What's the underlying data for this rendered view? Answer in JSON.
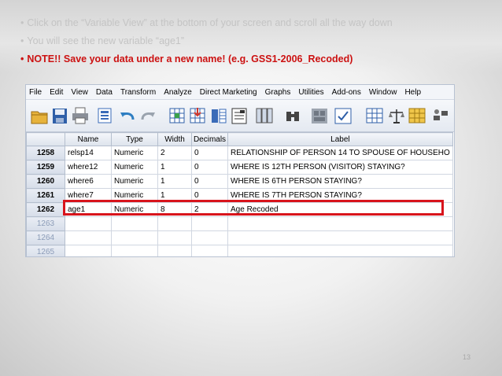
{
  "bullets": [
    {
      "text": "Click on the “Variable View” at the bottom of your screen and scroll all the way down",
      "style": "normal"
    },
    {
      "text": "You will see the new variable “age1”",
      "style": "normal"
    },
    {
      "text": "NOTE!! Save your data under a new name! (e.g. GSS1-2006_Recoded)",
      "style": "note"
    }
  ],
  "menu": [
    "File",
    "Edit",
    "View",
    "Data",
    "Transform",
    "Analyze",
    "Direct Marketing",
    "Graphs",
    "Utilities",
    "Add-ons",
    "Window",
    "Help"
  ],
  "toolbar_icons": [
    "open-folder-icon",
    "save-icon",
    "print-icon",
    "dialog-recall-icon",
    "undo-icon",
    "redo-icon",
    "goto-case-icon",
    "goto-variable-icon",
    "variables-icon",
    "insert-cases-icon",
    "insert-variable-icon",
    "find-icon",
    "split-file-icon",
    "weight-cases-icon",
    "select-cases-icon",
    "value-labels-icon",
    "scale-icon",
    "use-sets-icon"
  ],
  "grid": {
    "columns": [
      "",
      "Name",
      "Type",
      "Width",
      "Decimals",
      "Label"
    ],
    "rows": [
      {
        "num": "1258",
        "name": "relsp14",
        "type": "Numeric",
        "width": "2",
        "decimals": "0",
        "label": "RELATIONSHIP OF PERSON 14 TO SPOUSE OF HOUSEHO"
      },
      {
        "num": "1259",
        "name": "where12",
        "type": "Numeric",
        "width": "1",
        "decimals": "0",
        "label": "WHERE IS 12TH PERSON (VISITOR) STAYING?"
      },
      {
        "num": "1260",
        "name": "where6",
        "type": "Numeric",
        "width": "1",
        "decimals": "0",
        "label": "WHERE IS 6TH PERSON STAYING?"
      },
      {
        "num": "1261",
        "name": "where7",
        "type": "Numeric",
        "width": "1",
        "decimals": "0",
        "label": "WHERE IS 7TH PERSON STAYING?"
      },
      {
        "num": "1262",
        "name": "age1",
        "type": "Numeric",
        "width": "8",
        "decimals": "2",
        "label": "Age Recoded"
      },
      {
        "num": "1263",
        "name": "",
        "type": "",
        "width": "",
        "decimals": "",
        "label": ""
      },
      {
        "num": "1264",
        "name": "",
        "type": "",
        "width": "",
        "decimals": "",
        "label": ""
      },
      {
        "num": "1265",
        "name": "",
        "type": "",
        "width": "",
        "decimals": "",
        "label": ""
      }
    ]
  },
  "highlight_color": "#d8141c",
  "note_color": "#cc1111",
  "slide_number": "13"
}
